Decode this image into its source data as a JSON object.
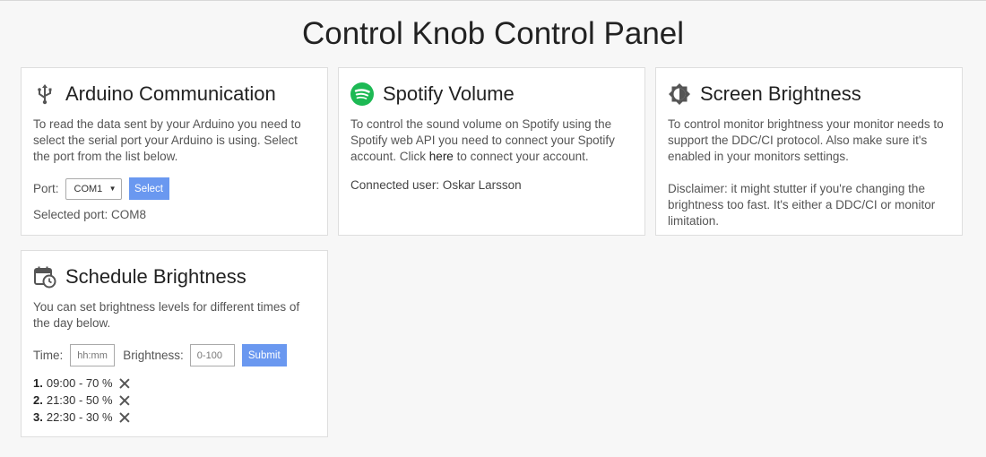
{
  "page_title": "Control Knob Control Panel",
  "arduino": {
    "title": "Arduino Communication",
    "icon": "usb-icon",
    "description": "To read the data sent by your Arduino you need to select the serial port your Arduino is using. Select the port from the list below.",
    "port_label": "Port:",
    "port_value": "COM1",
    "select_button": "Select",
    "selected_port": "Selected port: COM8"
  },
  "spotify": {
    "title": "Spotify Volume",
    "icon": "spotify-icon",
    "description_before": "To control the sound volume on Spotify using the Spotify web API you need to connect your Spotify account. Click ",
    "link_text": "here",
    "description_after": " to connect your account.",
    "connected_user": "Connected user: Oskar Larsson",
    "brand_color": "#1db954"
  },
  "screen": {
    "title": "Screen Brightness",
    "icon": "brightness-icon",
    "description": "To control monitor brightness your monitor needs to support the DDC/CI protocol. Also make sure it's enabled in your monitors settings.",
    "disclaimer": "Disclaimer: it might stutter if you're changing the brightness too fast. It's either a DDC/CI or monitor limitation."
  },
  "schedule": {
    "title": "Schedule Brightness",
    "icon": "calendar-clock-icon",
    "description": "You can set brightness levels for different times of the day below.",
    "time_label": "Time:",
    "time_placeholder": "hh:mm",
    "brightness_label": "Brightness:",
    "brightness_placeholder": "0-100",
    "submit_button": "Submit",
    "items": [
      {
        "num": "1.",
        "text": "09:00 - 70 %"
      },
      {
        "num": "2.",
        "text": "21:30 - 50 %"
      },
      {
        "num": "3.",
        "text": "22:30 - 30 %"
      }
    ]
  },
  "colors": {
    "accent_button": "#6a98f0"
  }
}
